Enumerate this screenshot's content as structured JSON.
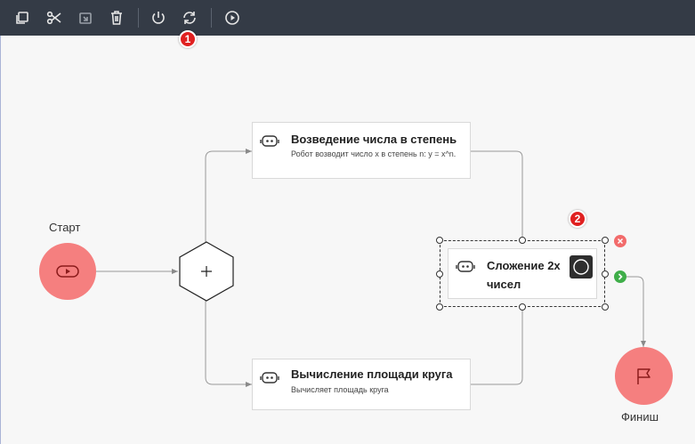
{
  "toolbar": {
    "buttons": [
      "copy",
      "cut",
      "paste",
      "delete",
      "power",
      "refresh",
      "run"
    ]
  },
  "markers": {
    "m1": "1",
    "m2": "2"
  },
  "start": {
    "label": "Старт"
  },
  "finish": {
    "label": "Финиш"
  },
  "nodes": {
    "power_node": {
      "title": "Возведение числа в степень",
      "desc": "Робот возводит число x в степень n: y = x^n."
    },
    "circle_area": {
      "title": "Вычисление площади круга",
      "desc": "Вычисляет площадь круга"
    },
    "sum_node": {
      "title_line1": "Сложение 2х",
      "title_line2": "чисел"
    }
  },
  "colors": {
    "toolbar_bg": "#343b46",
    "start_finish": "#f57f7f",
    "marker": "#e02020",
    "delete_badge": "#f26b6b",
    "connect_badge": "#3fae49"
  }
}
